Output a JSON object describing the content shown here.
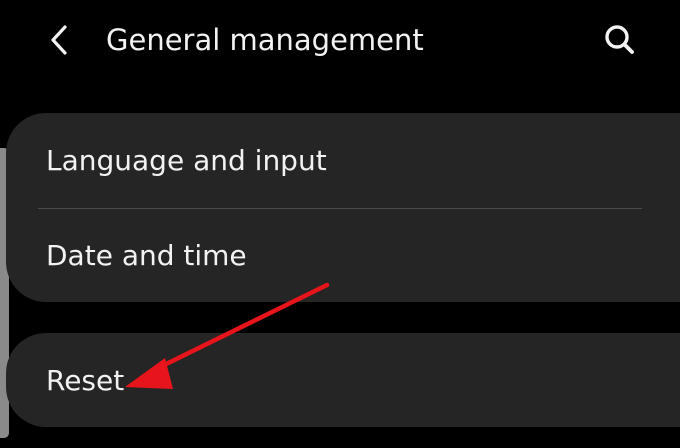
{
  "header": {
    "title": "General management",
    "back_icon": "chevron-left-icon",
    "search_icon": "search-icon"
  },
  "settings": {
    "group_1": [
      {
        "label": "Language and input"
      },
      {
        "label": "Date and time"
      }
    ],
    "group_2": [
      {
        "label": "Reset"
      }
    ]
  },
  "colors": {
    "background": "#000000",
    "card": "#252525",
    "text": "#f2f2f2",
    "divider": "#4a4a4a",
    "annotation_arrow": "#e8141b"
  }
}
